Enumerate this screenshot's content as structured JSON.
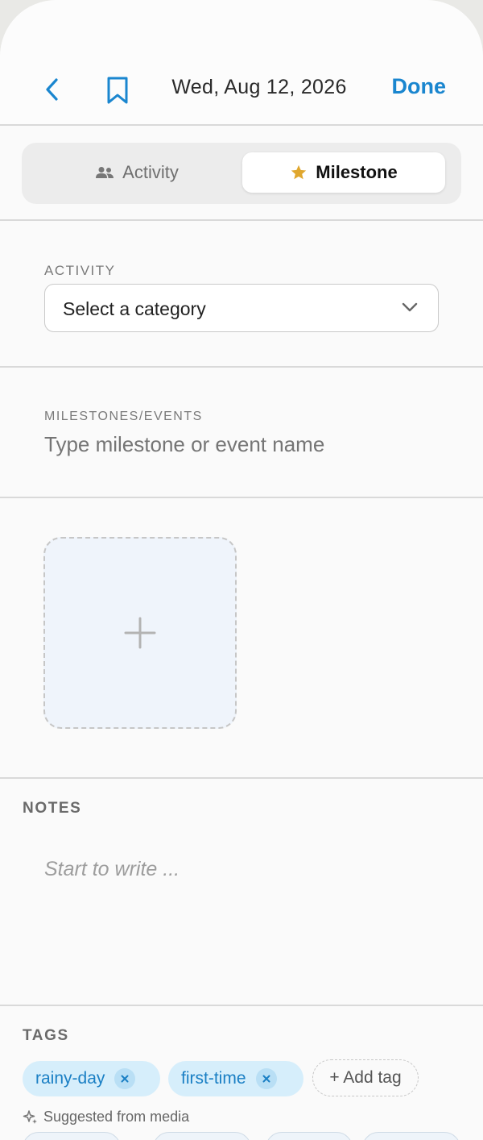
{
  "header": {
    "date": "Wed, Aug 12, 2026",
    "done_label": "Done",
    "accent_color": "#1a86cf"
  },
  "segment": {
    "activity_label": "Activity",
    "milestone_label": "Milestone",
    "selected": "Milestone"
  },
  "activity": {
    "label": "ACTIVITY",
    "select_value": "Select a category"
  },
  "milestones": {
    "label": "MILESTONES/EVENTS",
    "placeholder": "Type milestone or event name"
  },
  "notes": {
    "label": "NOTES",
    "placeholder": "Start to write ..."
  },
  "tags": {
    "label": "TAGS",
    "items": [
      "rainy-day",
      "first-time"
    ],
    "add_label": "+ Add tag",
    "suggested_label": "Suggested from media"
  }
}
